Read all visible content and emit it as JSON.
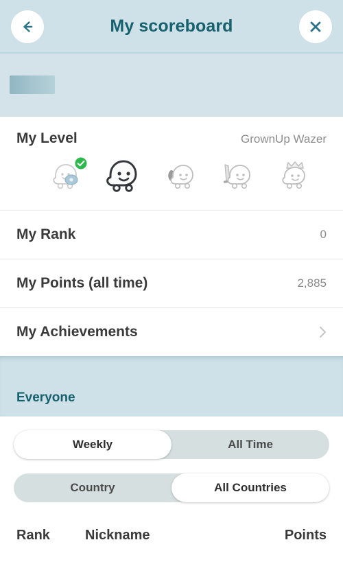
{
  "header": {
    "title": "My scoreboard",
    "back_icon": "arrow-left-icon",
    "close_icon": "close-icon"
  },
  "loading_placeholder": {
    "label": ""
  },
  "level": {
    "title": "My Level",
    "value": "GrownUp Wazer",
    "badges": [
      {
        "name": "baby-wazer-badge",
        "state": "completed",
        "check": "✓"
      },
      {
        "name": "grownup-wazer-badge",
        "state": "current"
      },
      {
        "name": "warrior-wazer-badge",
        "state": "locked"
      },
      {
        "name": "knight-wazer-badge",
        "state": "locked"
      },
      {
        "name": "royalty-wazer-badge",
        "state": "locked"
      }
    ]
  },
  "stats": [
    {
      "label": "My Rank",
      "value": "0",
      "chevron": false
    },
    {
      "label": "My Points (all time)",
      "value": "2,885",
      "chevron": false
    },
    {
      "label": "My Achievements",
      "value": "",
      "chevron": true
    }
  ],
  "everyone": {
    "title": "Everyone"
  },
  "toggles": {
    "time": {
      "options": [
        "Weekly",
        "All Time"
      ],
      "selected": "Weekly"
    },
    "scope": {
      "options": [
        "Country",
        "All Countries"
      ],
      "selected": "All Countries"
    }
  },
  "leaderboard": {
    "columns": [
      "Rank",
      "Nickname",
      "Points"
    ],
    "rows": []
  },
  "colors": {
    "header_bg": "#cfe1e8",
    "accent_teal": "#17616f",
    "band_bg": "#d3e3e9",
    "toggle_track": "#d6dfdf",
    "text_dark": "#3a3a3a",
    "text_muted": "#8a8a8a",
    "check_green": "#2db84c"
  }
}
